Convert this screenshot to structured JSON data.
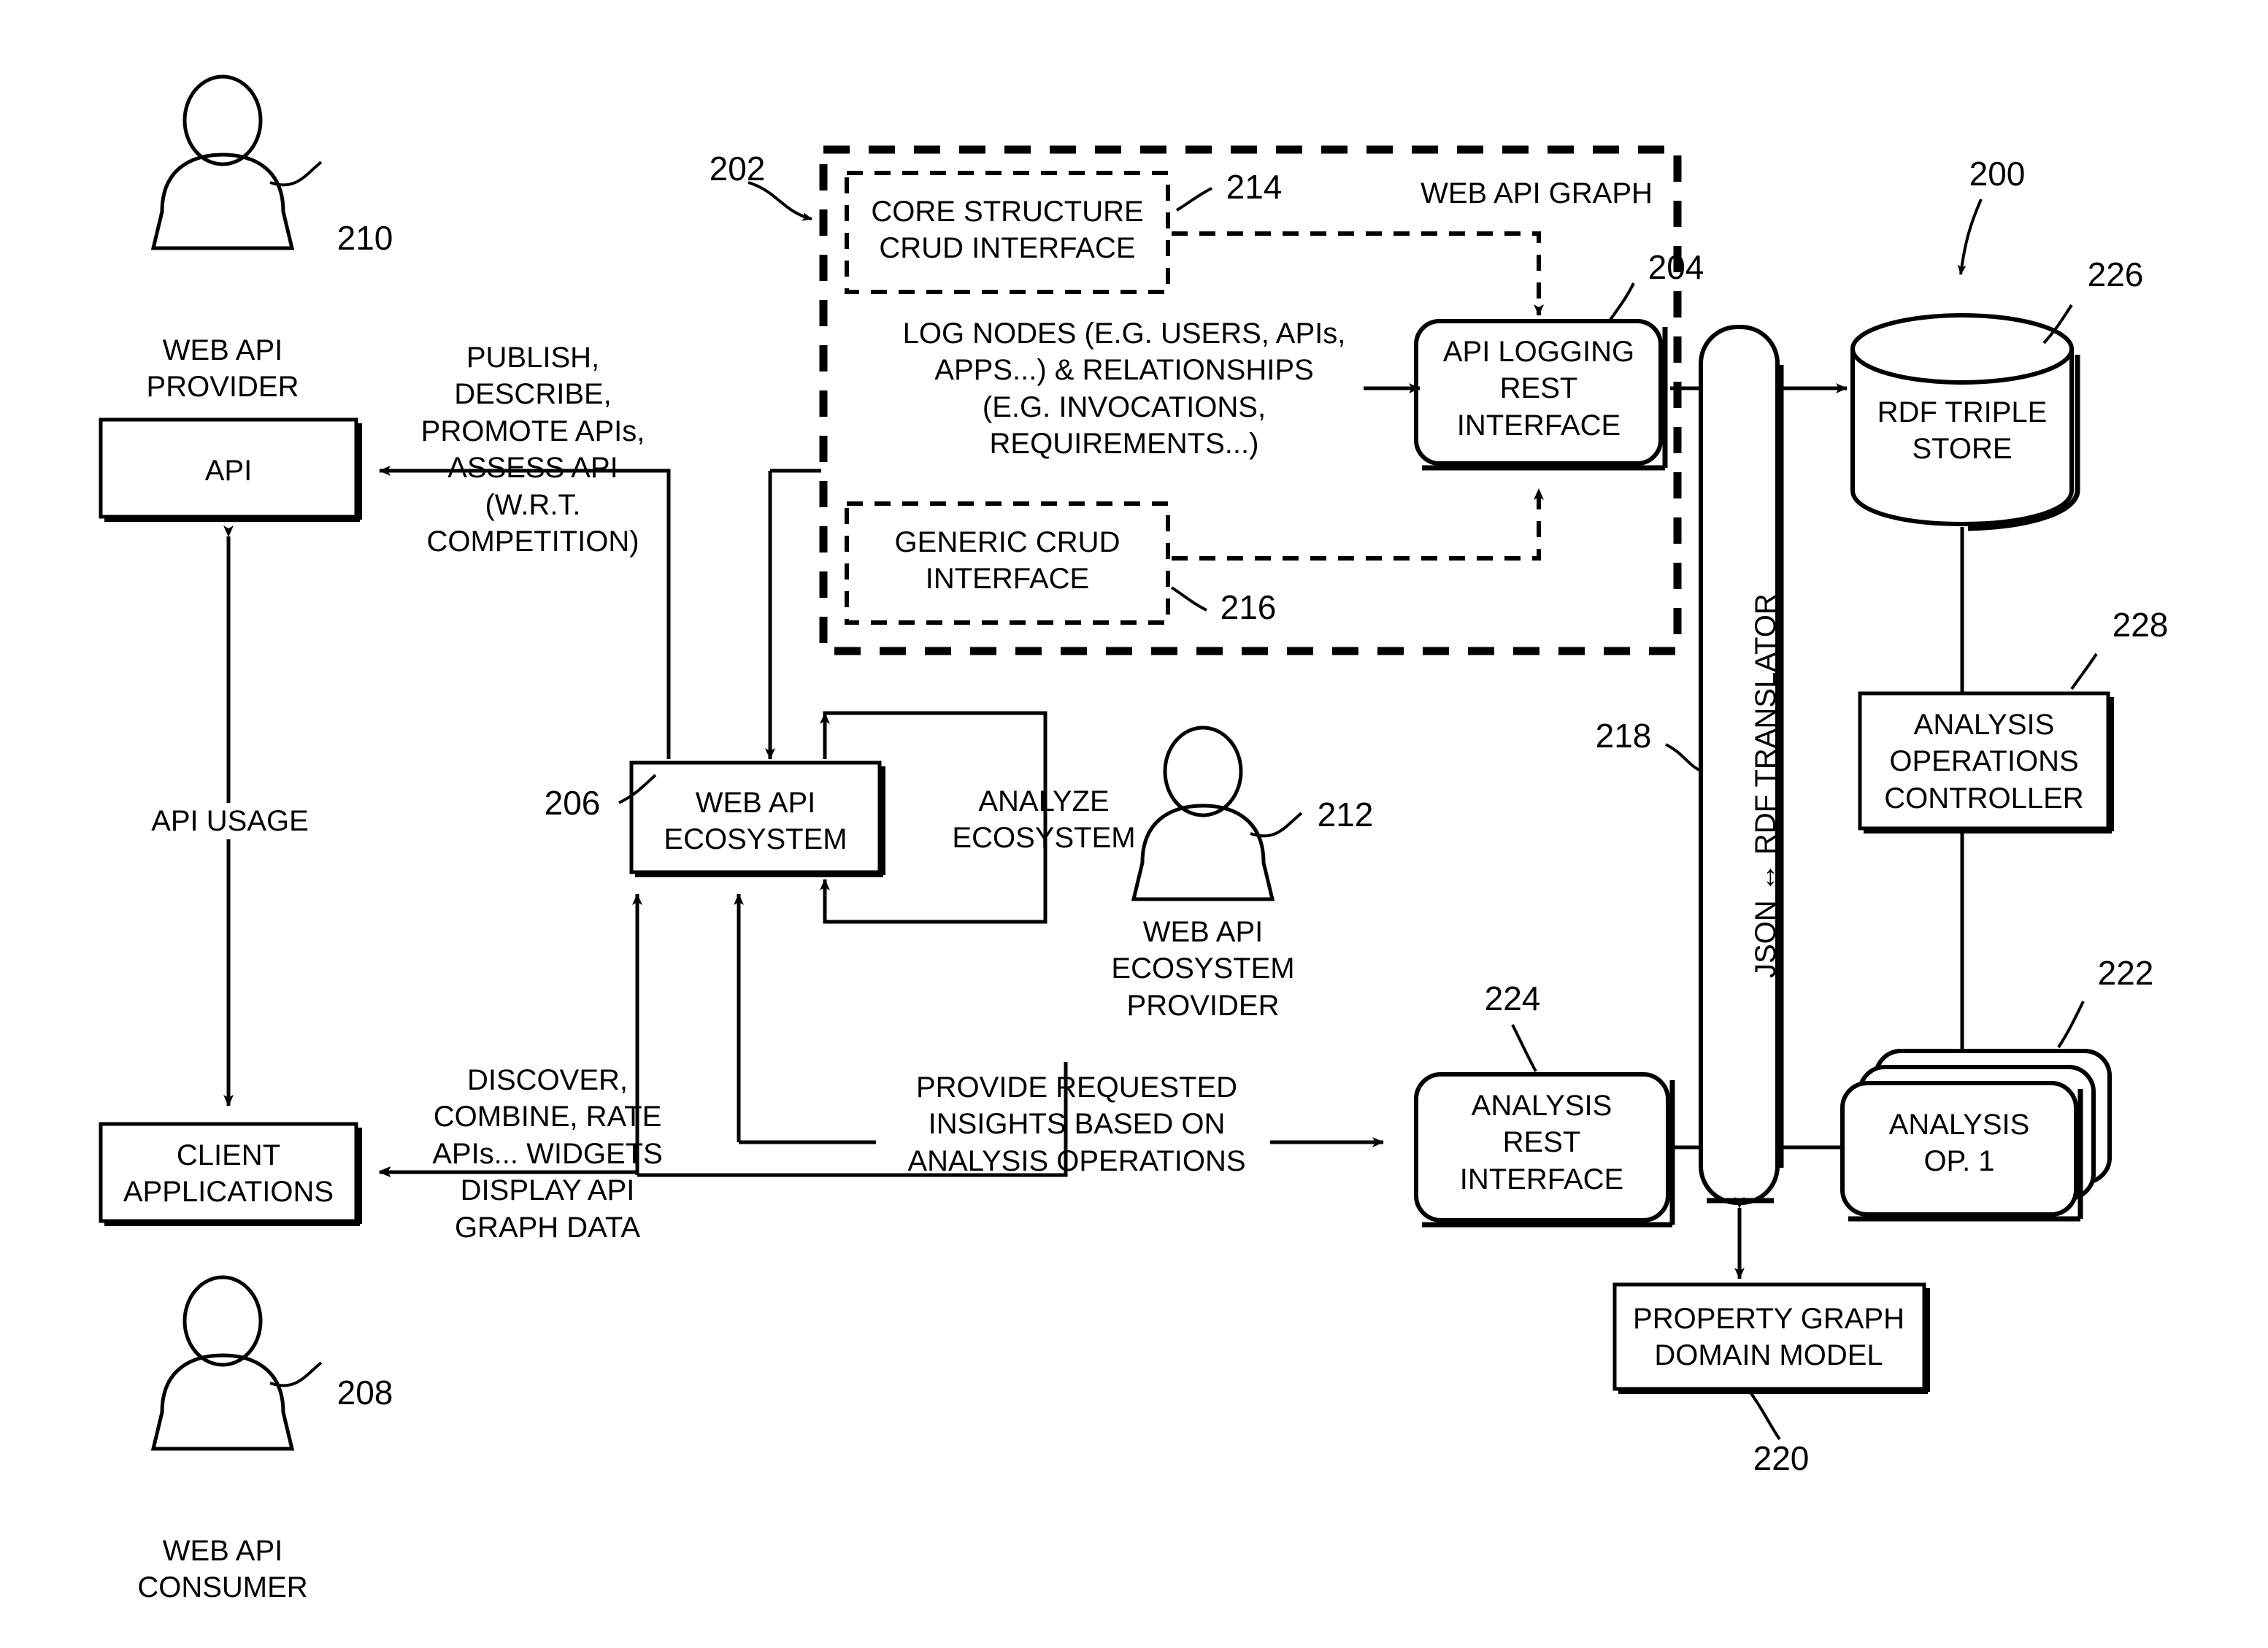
{
  "figure": {
    "type": "patent-block-diagram",
    "ref_200": "200",
    "ref_202": "202",
    "ref_204": "204",
    "ref_206": "206",
    "ref_208": "208",
    "ref_210": "210",
    "ref_212": "212",
    "ref_214": "214",
    "ref_216": "216",
    "ref_218": "218",
    "ref_220": "220",
    "ref_222": "222",
    "ref_224": "224",
    "ref_226": "226",
    "ref_228": "228"
  },
  "actors": {
    "web_api_provider": "WEB API\nPROVIDER",
    "web_api_consumer": "WEB API\nCONSUMER",
    "web_api_ecosystem_provider": "WEB API\nECOSYSTEM\nPROVIDER"
  },
  "nodes": {
    "api": "API",
    "client_applications": "CLIENT\nAPPLICATIONS",
    "web_api_ecosystem": "WEB API\nECOSYSTEM",
    "core_structure_crud": "CORE STRUCTURE\nCRUD INTERFACE",
    "generic_crud": "GENERIC CRUD\nINTERFACE",
    "api_logging_rest": "API LOGGING\nREST\nINTERFACE",
    "web_api_graph": "WEB API GRAPH",
    "json_rdf_translator": "JSON ↔ RDF TRANSLATOR",
    "rdf_triple_store": "RDF TRIPLE\nSTORE",
    "analysis_operations_controller": "ANALYSIS\nOPERATIONS\nCONTROLLER",
    "analysis_op_1": "ANALYSIS\nOP. 1",
    "analysis_rest_interface": "ANALYSIS\nREST\nINTERFACE",
    "property_graph_domain_model": "PROPERTY GRAPH\nDOMAIN MODEL"
  },
  "flows": {
    "publish_describe": "PUBLISH,\nDESCRIBE,\nPROMOTE APIs,\nASSESS API\n(W.R.T.\nCOMPETITION)",
    "api_usage": "API USAGE",
    "discover_combine": "DISCOVER,\nCOMBINE, RATE\nAPIs... WIDGETS\nDISPLAY API\nGRAPH DATA",
    "log_nodes": "LOG NODES (E.G. USERS, APIs,\nAPPS...) & RELATIONSHIPS\n(E.G. INVOCATIONS,\nREQUIREMENTS...)",
    "analyze_ecosystem": "ANALYZE\nECOSYSTEM",
    "provide_insights": "PROVIDE REQUESTED\nINSIGHTS BASED ON\nANALYSIS OPERATIONS"
  },
  "colors": {
    "stroke": "#000000",
    "background": "#ffffff"
  }
}
